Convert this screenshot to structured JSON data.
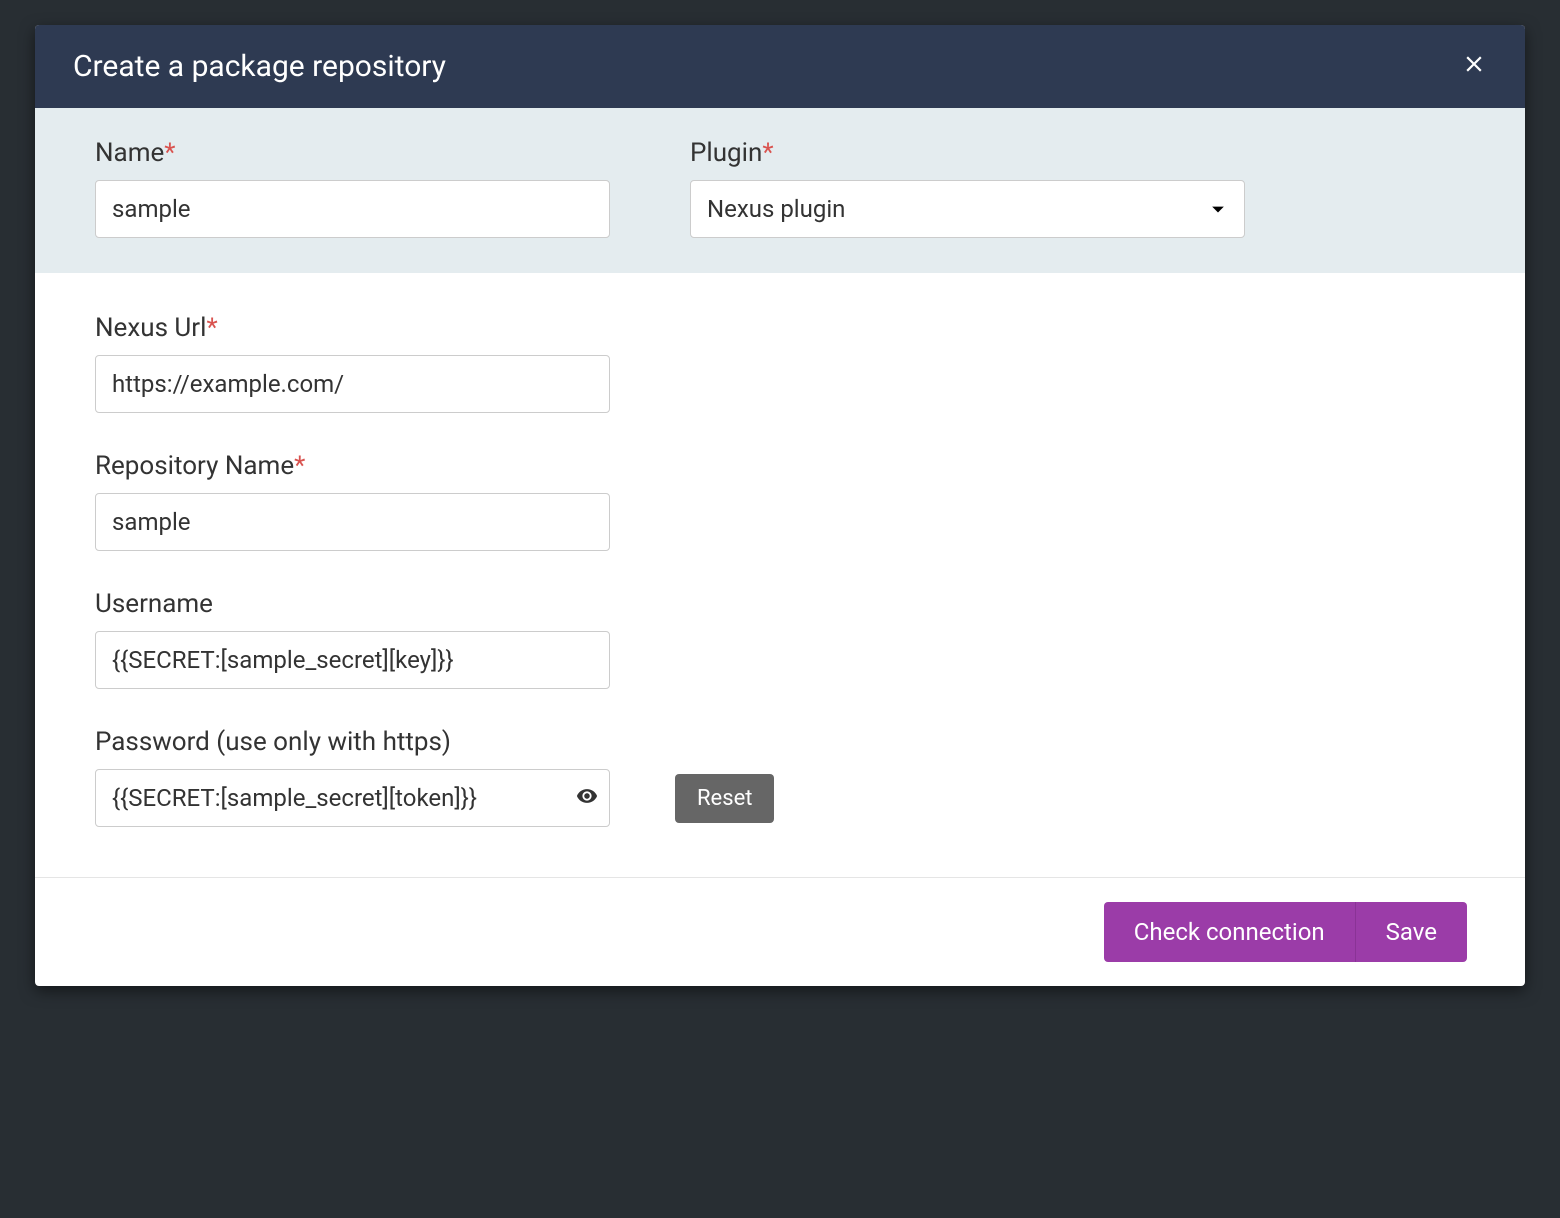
{
  "modal": {
    "title": "Create a package repository"
  },
  "top": {
    "name": {
      "label": "Name",
      "value": "sample"
    },
    "plugin": {
      "label": "Plugin",
      "selected": "Nexus plugin"
    }
  },
  "body": {
    "nexus_url": {
      "label": "Nexus Url",
      "value": "https://example.com/"
    },
    "repository_name": {
      "label": "Repository Name",
      "value": "sample"
    },
    "username": {
      "label": "Username",
      "value": "{{SECRET:[sample_secret][key]}}"
    },
    "password": {
      "label": "Password (use only with https)",
      "value": "{{SECRET:[sample_secret][token]}}",
      "reset_label": "Reset"
    }
  },
  "footer": {
    "check_connection": "Check connection",
    "save": "Save"
  }
}
